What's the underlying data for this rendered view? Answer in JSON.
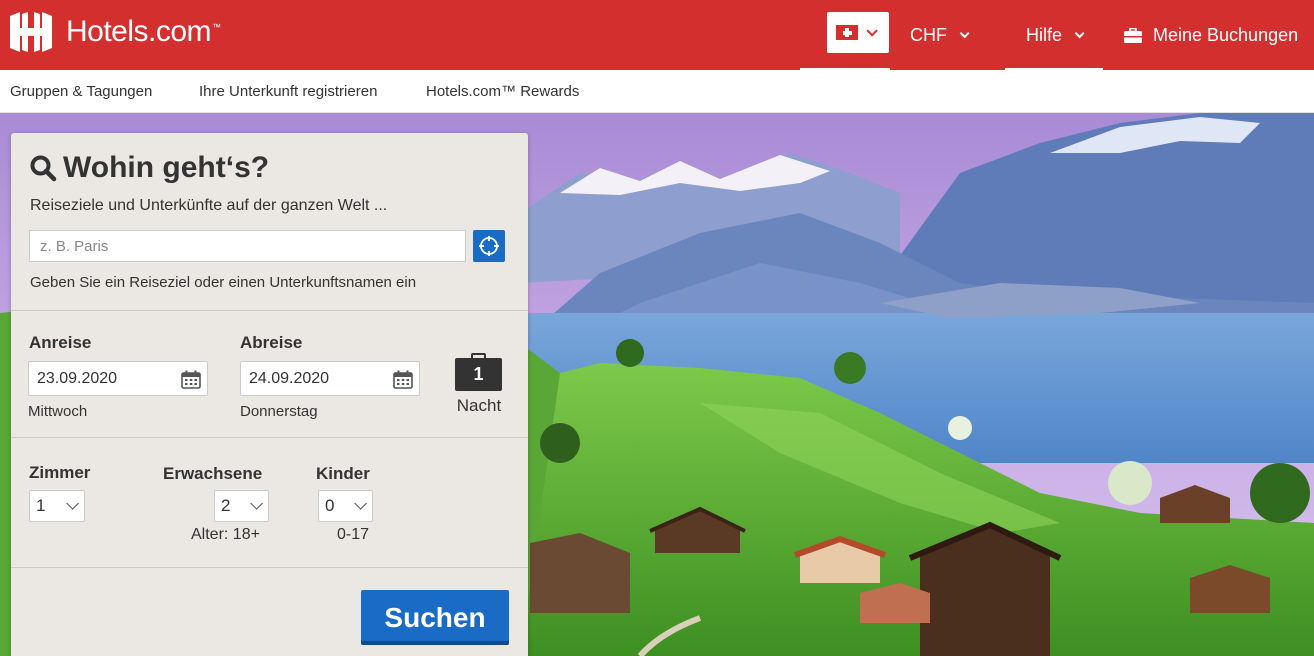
{
  "header": {
    "brand": "Hotels.com",
    "brand_tm": "™",
    "currency": "CHF",
    "help": "Hilfe",
    "bookings": "Meine Buchungen"
  },
  "subnav": {
    "items": [
      "Gruppen & Tagungen",
      "Ihre Unterkunft registrieren",
      "Hotels.com™ Rewards"
    ]
  },
  "search": {
    "title": "Wohin geht‘s?",
    "subtitle": "Reiseziele und Unterkünfte auf der ganzen Welt ...",
    "placeholder": "z. B. Paris",
    "hint": "Geben Sie ein Reiseziel oder einen Unterkunftsnamen ein",
    "checkin_label": "Anreise",
    "checkin_date": "23.09.2020",
    "checkin_weekday": "Mittwoch",
    "checkout_label": "Abreise",
    "checkout_date": "24.09.2020",
    "checkout_weekday": "Donnerstag",
    "nights_count": "1",
    "nights_label": "Nacht",
    "rooms_label": "Zimmer",
    "rooms_value": "1",
    "adults_label": "Erwachsene",
    "adults_value": "2",
    "adults_age": "Alter: 18+",
    "children_label": "Kinder",
    "children_value": "0",
    "children_age": "0-17",
    "submit": "Suchen"
  },
  "colors": {
    "brand_red": "#d32f2f",
    "action_blue": "#1a6bc6",
    "panel_bg": "#ebe7e2"
  },
  "icons": {
    "logo": "hotels-logo-icon",
    "search": "search-icon",
    "locate": "locate-icon",
    "calendar": "calendar-icon",
    "suitcase": "suitcase-icon",
    "bag": "briefcase-icon",
    "flag": "swiss-flag-icon"
  }
}
